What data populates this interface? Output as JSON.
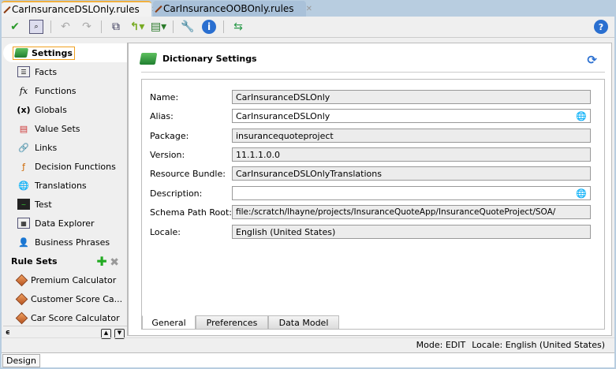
{
  "tabs": [
    {
      "label": "CarInsuranceDSLOnly.rules",
      "active": true
    },
    {
      "label": "CarInsuranceOOBOnly.rules",
      "active": false
    }
  ],
  "toolbar": {
    "icons": [
      "validate-check-icon",
      "preview-icon",
      "undo-icon",
      "redo-icon",
      "link-icon",
      "upload-icon",
      "excel-icon",
      "wrench-icon",
      "info-icon",
      "merge-icon",
      "help-icon"
    ]
  },
  "sidebar": {
    "items": [
      {
        "label": "Settings",
        "icon": "book-icon"
      },
      {
        "label": "Facts",
        "icon": "facts-icon"
      },
      {
        "label": "Functions",
        "icon": "fx-icon"
      },
      {
        "label": "Globals",
        "icon": "globals-icon"
      },
      {
        "label": "Value Sets",
        "icon": "valueset-icon"
      },
      {
        "label": "Links",
        "icon": "link-icon"
      },
      {
        "label": "Decision Functions",
        "icon": "decision-icon"
      },
      {
        "label": "Translations",
        "icon": "translation-icon"
      },
      {
        "label": "Test",
        "icon": "test-icon"
      },
      {
        "label": "Data Explorer",
        "icon": "explorer-icon"
      },
      {
        "label": "Business Phrases",
        "icon": "phrases-icon"
      }
    ],
    "rule_sets_label": "Rule Sets",
    "rule_sets": [
      "Premium Calculator",
      "Customer Score Ca...",
      "Car Score Calculator"
    ]
  },
  "main": {
    "title": "Dictionary Settings",
    "fields": [
      {
        "label": "Name:",
        "value": "CarInsuranceDSLOnly",
        "editable": false
      },
      {
        "label": "Alias:",
        "value": "CarInsuranceDSLOnly",
        "editable": true
      },
      {
        "label": "Package:",
        "value": "insurancequoteproject",
        "editable": false
      },
      {
        "label": "Version:",
        "value": "11.1.1.0.0",
        "editable": false
      },
      {
        "label": "Resource Bundle:",
        "value": "CarInsuranceDSLOnlyTranslations",
        "editable": false
      },
      {
        "label": "Description:",
        "value": "",
        "editable": true
      },
      {
        "label": "Schema Path Root:",
        "value": "file:/scratch/lhayne/projects/InsuranceQuoteApp/InsuranceQuoteProject/SOA/",
        "editable": false
      },
      {
        "label": "Locale:",
        "value": "English (United States)",
        "editable": false
      }
    ],
    "bottom_tabs": [
      "General",
      "Preferences",
      "Data Model"
    ]
  },
  "status": {
    "mode": "Mode: EDIT",
    "locale": "Locale: English (United States)"
  },
  "editor_tab": "Design"
}
